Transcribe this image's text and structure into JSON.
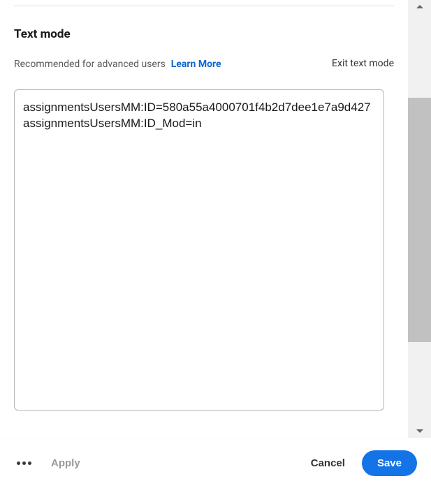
{
  "section": {
    "title": "Text mode",
    "recommended": "Recommended for advanced users",
    "learn_more": "Learn More",
    "exit_link": "Exit text mode"
  },
  "editor": {
    "content": "assignmentsUsersMM:ID=580a55a4000701f4b2d7dee1e7a9d427\nassignmentsUsersMM:ID_Mod=in"
  },
  "footer": {
    "apply": "Apply",
    "cancel": "Cancel",
    "save": "Save"
  }
}
